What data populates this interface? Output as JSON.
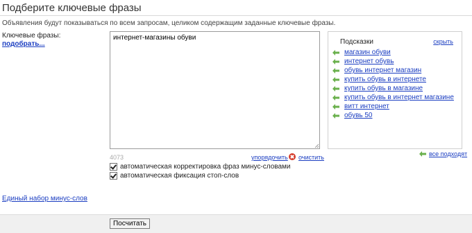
{
  "page": {
    "title": "Подберите ключевые фразы",
    "subtitle": "Объявления будут показываться по всем запросам, целиком содержащим заданные ключевые фразы."
  },
  "keywords": {
    "label": "Ключевые фразы:",
    "pick_link": "подобрать...",
    "value": "интернет-магазины обуви",
    "count": "4073",
    "sort_label": "упорядочить",
    "clear_label": "очистить"
  },
  "options": [
    {
      "label": "автоматическая корректировка фраз минус-словами",
      "checked": true
    },
    {
      "label": "автоматическая фиксация стоп-слов",
      "checked": true
    }
  ],
  "hints": {
    "title": "Подсказки",
    "hide_label": "скрыть",
    "items": [
      "магазин обуви",
      "интернет обувь",
      "обувь интернет магазин",
      "купить обувь в интернете",
      "купить обувь в магазине",
      "купить обувь в интернет магазине",
      "витт интернет",
      "обувь 50"
    ],
    "all_fit_label": "все подходят",
    "arrow_color": "#6ab04c"
  },
  "minus_words_link": "Единый набор минус-слов",
  "submit_label": "Посчитать"
}
